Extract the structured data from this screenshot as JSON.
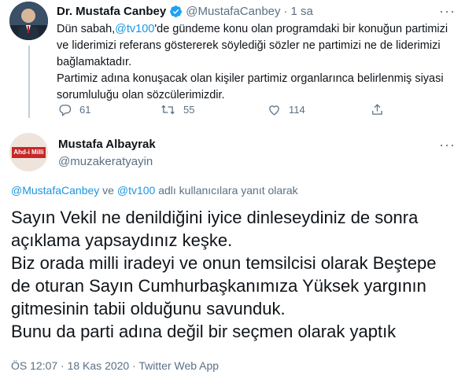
{
  "parent_tweet": {
    "author_name": "Dr. Mustafa Canbey",
    "handle": "@MustafaCanbey",
    "separator": "·",
    "time": "1 sa",
    "text_part1": "Dün sabah,",
    "mention": "@tv100",
    "text_part2": "'de gündeme konu olan programdaki bir konuğun partimizi ve liderimizi referans göstererek söylediği sözler ne partimizi ne de liderimizi bağlamaktadır.",
    "text_para2": "Partimiz adına konuşacak olan kişiler partimiz organlarınca belirlenmiş siyasi sorumluluğu olan sözcülerimizdir.",
    "replies": "61",
    "retweets": "55",
    "likes": "114",
    "more": "···"
  },
  "main_tweet": {
    "author_name": "Mustafa Albayrak",
    "handle": "@muzakeratyayin",
    "avatar_text": "Ahd-i Milli",
    "more": "···",
    "reply_mention1": "@MustafaCanbey",
    "reply_and": "ve",
    "reply_mention2": "@tv100",
    "reply_suffix": "adlı kullanıcılara yanıt olarak",
    "lines": [
      "Sayın Vekil ne denildiğini iyice dinleseydiniz de sonra",
      "açıklama yapsaydınız keşke.",
      "Biz orada milli iradeyi ve onun temsilcisi olarak Beştepe",
      "de oturan Sayın Cumhurbaşkanımıza Yüksek yargının",
      "gitmesinin tabii olduğunu savunduk.",
      "Bunu da parti adına değil bir seçmen olarak yaptık"
    ],
    "meta": "ÖS 12:07 · 18 Kas 2020 · Twitter Web App"
  },
  "colors": {
    "accent": "#1b95e0",
    "verified": "#1da1f2",
    "muted": "#5b7083",
    "divider": "#e6ecf0"
  }
}
